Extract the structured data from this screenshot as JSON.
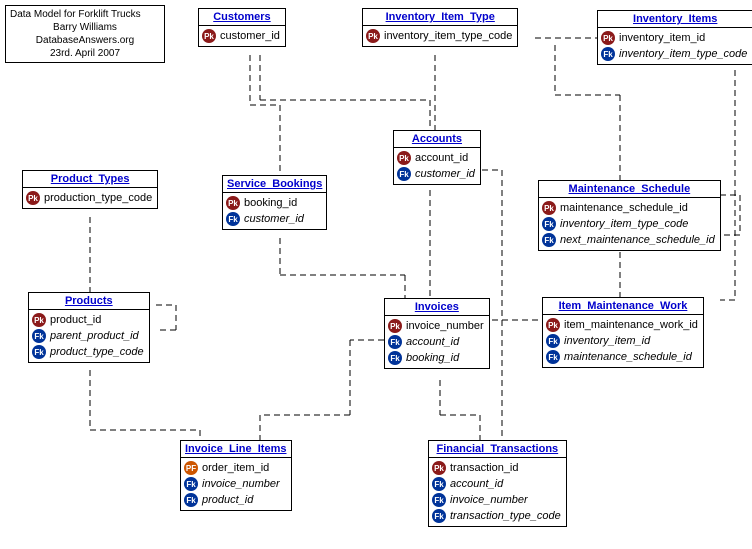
{
  "info": {
    "l1": "Data Model for Forklift Trucks",
    "l2": "Barry Williams",
    "l3": "DatabaseAnswers.org",
    "l4": "23rd. April  2007"
  },
  "entities": {
    "customers": {
      "title": "Customers",
      "rows": [
        {
          "k": "pk",
          "t": "customer_id"
        }
      ]
    },
    "inventory_item_type": {
      "title": "Inventory_Item_Type",
      "rows": [
        {
          "k": "pk",
          "t": "inventory_item_type_code"
        }
      ]
    },
    "inventory_items": {
      "title": "Inventory_Items",
      "rows": [
        {
          "k": "pk",
          "t": "inventory_item_id"
        },
        {
          "k": "fk",
          "t": "inventory_item_type_code"
        }
      ]
    },
    "accounts": {
      "title": "Accounts",
      "rows": [
        {
          "k": "pk",
          "t": "account_id"
        },
        {
          "k": "fk",
          "t": "customer_id"
        }
      ]
    },
    "product_types": {
      "title": "Product_Types",
      "rows": [
        {
          "k": "pk",
          "t": "production_type_code"
        }
      ]
    },
    "service_bookings": {
      "title": "Service_Bookings",
      "rows": [
        {
          "k": "pk",
          "t": "booking_id"
        },
        {
          "k": "fk",
          "t": "customer_id"
        }
      ]
    },
    "maintenance_schedule": {
      "title": "Maintenance_Schedule",
      "rows": [
        {
          "k": "pk",
          "t": "maintenance_schedule_id"
        },
        {
          "k": "fk",
          "t": "inventory_item_type_code"
        },
        {
          "k": "fk",
          "t": "next_maintenance_schedule_id"
        }
      ]
    },
    "products": {
      "title": "Products",
      "rows": [
        {
          "k": "pk",
          "t": "product_id"
        },
        {
          "k": "fk",
          "t": "parent_product_id"
        },
        {
          "k": "fk",
          "t": "product_type_code"
        }
      ]
    },
    "invoices": {
      "title": "Invoices",
      "rows": [
        {
          "k": "pk",
          "t": "invoice_number"
        },
        {
          "k": "fk",
          "t": "account_id"
        },
        {
          "k": "fk",
          "t": "booking_id"
        }
      ]
    },
    "item_maintenance_work": {
      "title": "Item_Maintenance_Work",
      "rows": [
        {
          "k": "pk",
          "t": "item_maintenance_work_id"
        },
        {
          "k": "fk",
          "t": "inventory_item_id"
        },
        {
          "k": "fk",
          "t": "maintenance_schedule_id"
        }
      ]
    },
    "invoice_line_items": {
      "title": "Invoice_Line_Items",
      "rows": [
        {
          "k": "pf",
          "t": "order_item_id"
        },
        {
          "k": "fk",
          "t": "invoice_number"
        },
        {
          "k": "fk",
          "t": "product_id"
        }
      ]
    },
    "financial_transactions": {
      "title": "Financial_Transactions",
      "rows": [
        {
          "k": "pk",
          "t": "transaction_id"
        },
        {
          "k": "fk",
          "t": "account_id"
        },
        {
          "k": "fk",
          "t": "invoice_number"
        },
        {
          "k": "fk",
          "t": "transaction_type_code"
        }
      ]
    }
  },
  "key_labels": {
    "pk": "Pk",
    "fk": "Fk",
    "pf": "PF"
  }
}
